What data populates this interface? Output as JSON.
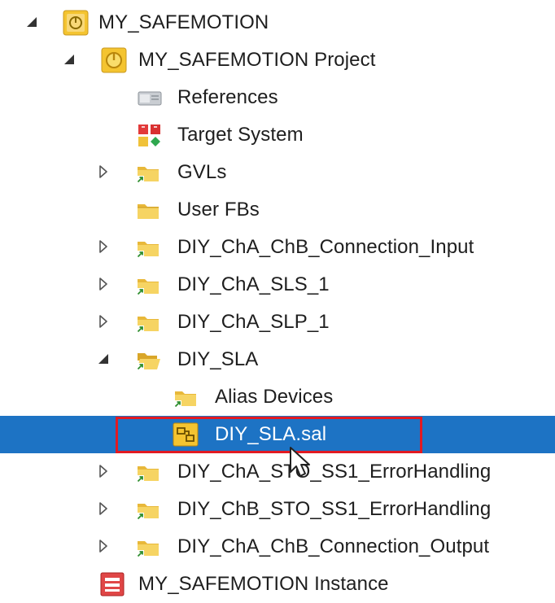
{
  "tree": {
    "root": {
      "label": "MY_SAFEMOTION",
      "icon": "safety-project-group-icon"
    },
    "project": {
      "label": "MY_SAFEMOTION Project",
      "icon": "safety-project-icon"
    },
    "references": {
      "label": "References",
      "icon": "references-icon"
    },
    "target_system": {
      "label": "Target System",
      "icon": "target-system-icon"
    },
    "gvls": {
      "label": "GVLs",
      "icon": "folder-icon"
    },
    "user_fbs": {
      "label": "User FBs",
      "icon": "folder-icon"
    },
    "conn_input": {
      "label": "DIY_ChA_ChB_Connection_Input",
      "icon": "folder-icon"
    },
    "sls": {
      "label": "DIY_ChA_SLS_1",
      "icon": "folder-icon"
    },
    "slp": {
      "label": "DIY_ChA_SLP_1",
      "icon": "folder-icon"
    },
    "sla": {
      "label": "DIY_SLA",
      "icon": "open-folder-icon"
    },
    "alias_devices": {
      "label": "Alias Devices",
      "icon": "folder-icon"
    },
    "sla_file": {
      "label": "DIY_SLA.sal",
      "icon": "safety-application-file-icon"
    },
    "cha_sto": {
      "label": "DIY_ChA_STO_SS1_ErrorHandling",
      "icon": "folder-icon"
    },
    "chb_sto": {
      "label": "DIY_ChB_STO_SS1_ErrorHandling",
      "icon": "folder-icon"
    },
    "conn_output": {
      "label": "DIY_ChA_ChB_Connection_Output",
      "icon": "folder-icon"
    },
    "instance": {
      "label": "MY_SAFEMOTION Instance",
      "icon": "safety-instance-icon"
    }
  },
  "colors": {
    "selection": "#1d73c4",
    "highlight_box": "#e21a22",
    "folder": "#f2c94c"
  }
}
